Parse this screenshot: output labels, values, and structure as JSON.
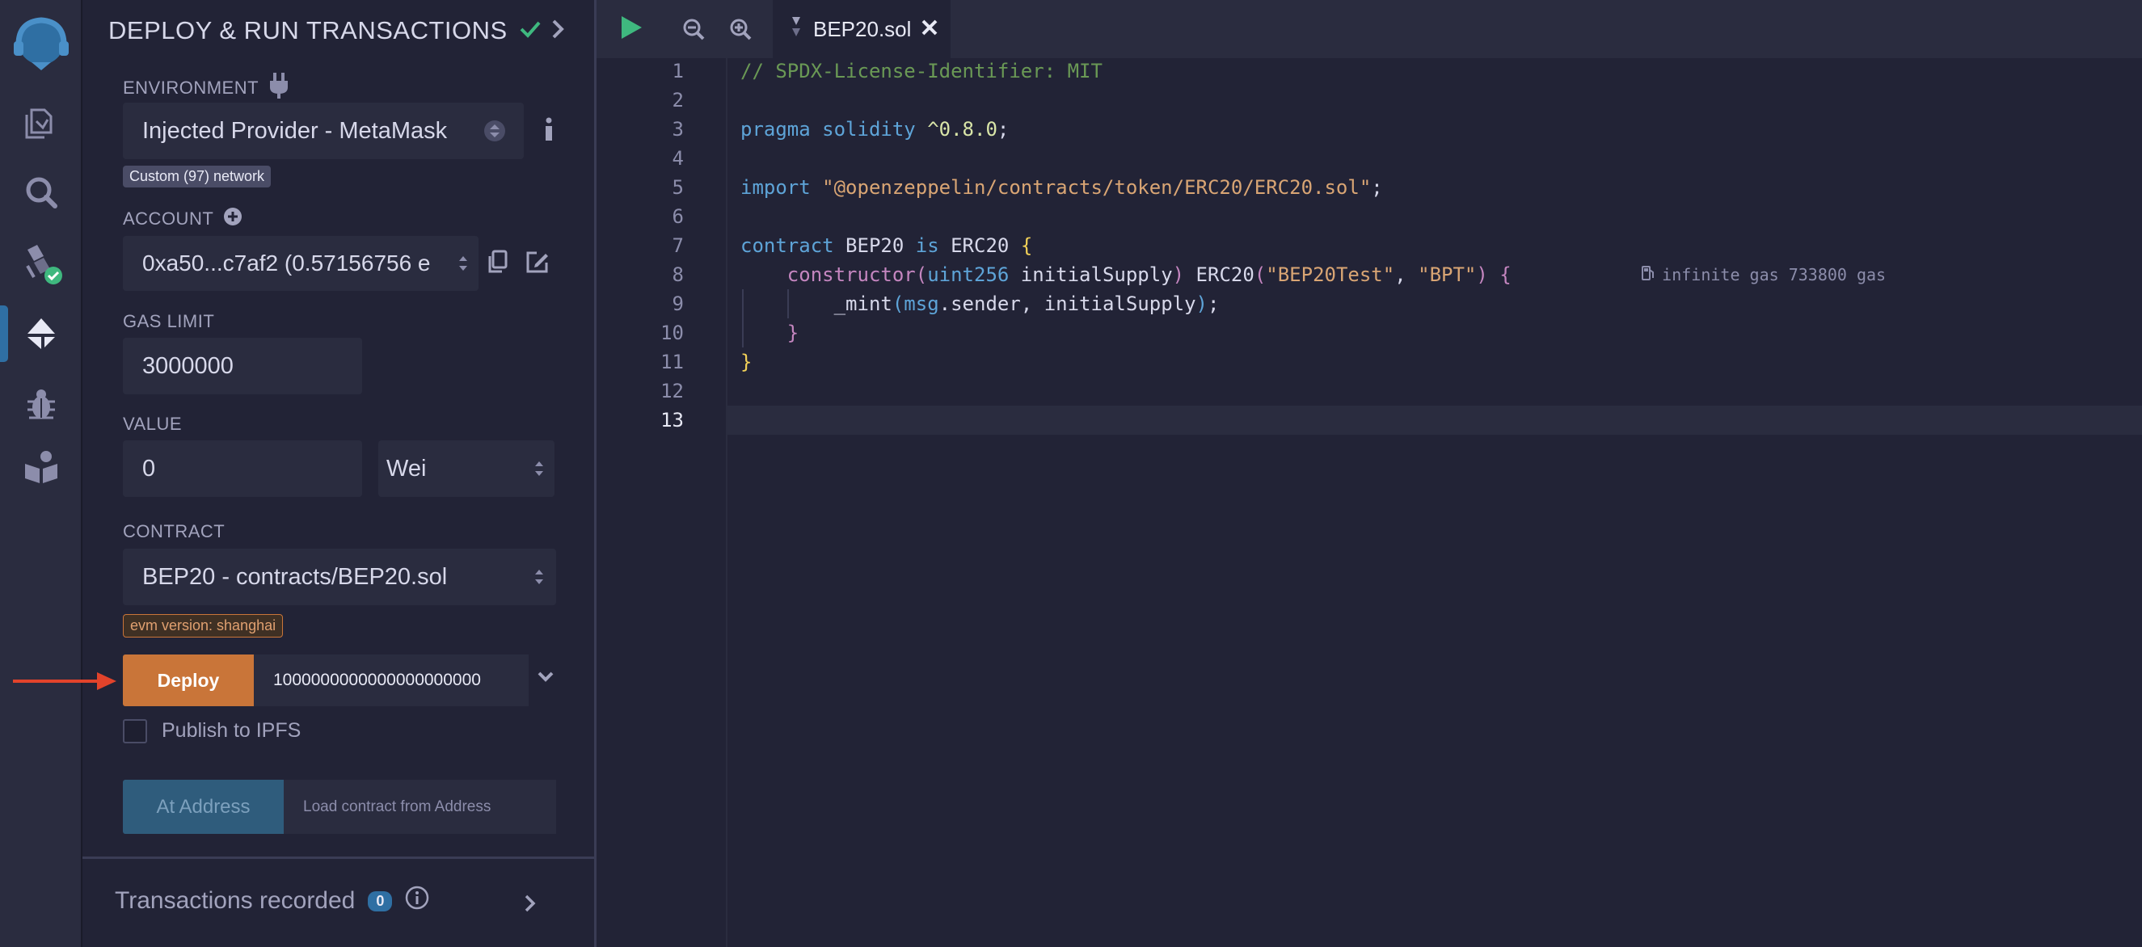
{
  "panel": {
    "title": "DEPLOY & RUN TRANSACTIONS",
    "environment_label": "ENVIRONMENT",
    "environment_value": "Injected Provider - MetaMask",
    "network_badge": "Custom (97) network",
    "account_label": "ACCOUNT",
    "account_value": "0xa50...c7af2 (0.57156756 e",
    "gas_limit_label": "GAS LIMIT",
    "gas_limit_value": "3000000",
    "value_label": "VALUE",
    "value_amount": "0",
    "value_unit": "Wei",
    "contract_label": "CONTRACT",
    "contract_value": "BEP20 - contracts/BEP20.sol",
    "evm_badge": "evm version: shanghai",
    "deploy_label": "Deploy",
    "deploy_arg": "1000000000000000000000",
    "publish_label": "Publish to IPFS",
    "at_address_label": "At Address",
    "at_address_placeholder": "Load contract from Address",
    "transactions_label": "Transactions recorded",
    "transactions_count": "0"
  },
  "editor": {
    "tab_name": "BEP20.sol",
    "line_numbers": [
      "1",
      "2",
      "3",
      "4",
      "5",
      "6",
      "7",
      "8",
      "9",
      "10",
      "11",
      "12",
      "13"
    ],
    "gas_estimate": "infinite gas 733800 gas",
    "code": {
      "l1": "// SPDX-License-Identifier: MIT",
      "l3_kw": "pragma solidity",
      "l3_ver": " ^0.8.0",
      "l3_end": ";",
      "l5_kw": "import",
      "l5_str": " \"@openzeppelin/contracts/token/ERC20/ERC20.sol\"",
      "l5_end": ";",
      "l7_a": "contract",
      "l7_b": " BEP20 ",
      "l7_c": "is",
      "l7_d": " ERC20 ",
      "l7_e": "{",
      "l8_indent": "    ",
      "l8_a": "constructor",
      "l8_b": "(",
      "l8_c": "uint256",
      "l8_d": " initialSupply",
      "l8_e": ")",
      "l8_f": " ERC20",
      "l8_g": "(",
      "l8_h": "\"BEP20Test\"",
      "l8_i": ", ",
      "l8_j": "\"BPT\"",
      "l8_k": ")",
      "l8_l": " {",
      "l9_indent": "        ",
      "l9_a": "_mint",
      "l9_b": "(",
      "l9_c": "msg",
      "l9_d": ".sender, initialSupply",
      "l9_e": ")",
      "l9_f": ";",
      "l10_indent": "    ",
      "l10_a": "}",
      "l11_a": "}"
    }
  },
  "icons": [
    "remix-logo-icon",
    "file-explorer-icon",
    "search-icon",
    "solidity-compiler-icon",
    "deploy-run-icon",
    "debugger-icon",
    "learneth-icon",
    "plug-icon",
    "info-icon",
    "plus-circle-icon",
    "copy-icon",
    "edit-icon",
    "chevron-down-icon",
    "chevron-right-icon",
    "play-icon",
    "zoom-out-icon",
    "zoom-in-icon",
    "close-icon",
    "gas-pump-icon",
    "check-icon"
  ],
  "colors": {
    "deploy_button": "#c97539",
    "at_address_button": "#2f5c7c",
    "accent_blue": "#2f6fa3",
    "check_green": "#3fb87f",
    "arrow_red": "#e2432b"
  }
}
